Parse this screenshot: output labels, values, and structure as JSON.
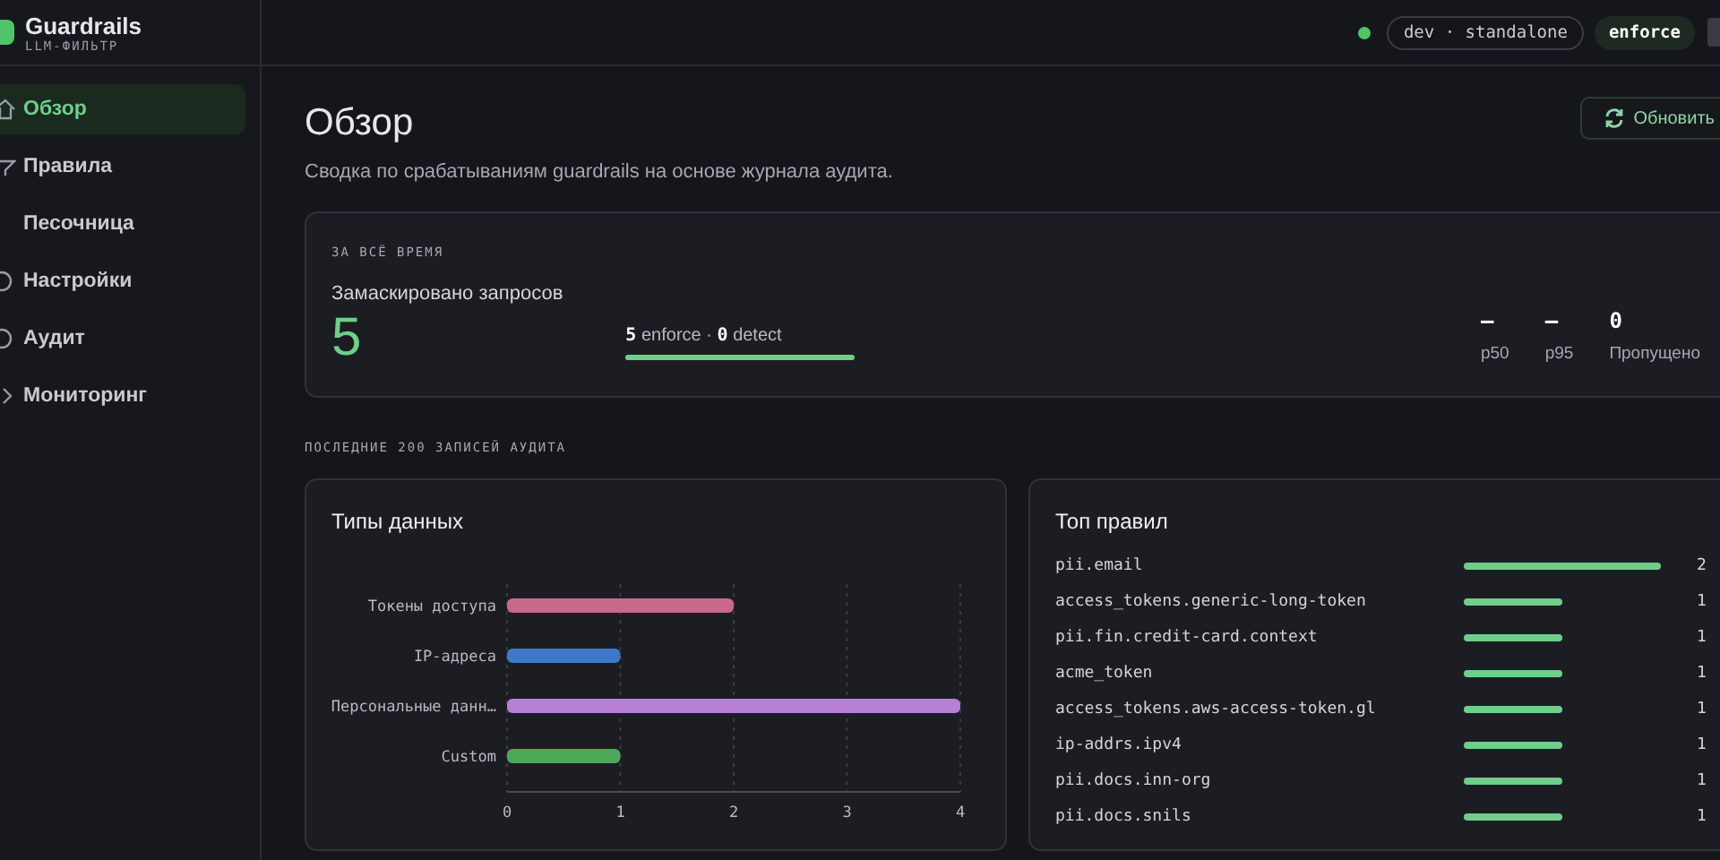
{
  "brand": {
    "title": "Guardrails",
    "subtitle": "LLM-ФИЛЬТР"
  },
  "sidebar": {
    "items": [
      {
        "label": "Обзор",
        "selected": true
      },
      {
        "label": "Правила",
        "selected": false
      },
      {
        "label": "Песочница",
        "selected": false
      },
      {
        "label": "Настройки",
        "selected": false
      },
      {
        "label": "Аудит",
        "selected": false
      },
      {
        "label": "Мониторинг",
        "selected": false
      }
    ]
  },
  "topbar": {
    "environment": "dev · standalone",
    "mode": "enforce"
  },
  "page": {
    "title": "Обзор",
    "subtitle": "Сводка по срабатываниям guardrails на основе журнала аудита.",
    "refresh_button": "Обновить"
  },
  "summary": {
    "section": "ЗА ВСЁ ВРЕМЯ",
    "label": "Замаскировано запросов",
    "value": "5",
    "enforce_count": "5",
    "enforce_label": "enforce",
    "separator": "·",
    "detect_count": "0",
    "detect_label": "detect",
    "level": 1,
    "stats": [
      {
        "value": "—",
        "label": "p50"
      },
      {
        "value": "—",
        "label": "p95"
      },
      {
        "value": "0",
        "label": "Пропущено"
      }
    ]
  },
  "recent_heading": "ПОСЛЕДНИЕ 200 ЗАПИСЕЙ АУДИТА",
  "data_types": {
    "title": "Типы данных",
    "chart_data": {
      "type": "bar",
      "orientation": "horizontal",
      "categories": [
        "Токены доступа",
        "IP-адреса",
        "Персональные данн…",
        "Custom"
      ],
      "values": [
        2,
        1,
        4,
        1
      ],
      "colors": [
        "#c8698c",
        "#3f78c8",
        "#b77fd6",
        "#4ea85a"
      ],
      "xlim": [
        0,
        4
      ],
      "xticks": [
        0,
        1,
        2,
        3,
        4
      ],
      "grid": true
    }
  },
  "top_rules": {
    "title": "Топ правил",
    "rows": [
      {
        "name": "pii.email",
        "count": "2"
      },
      {
        "name": "access_tokens.generic-long-token",
        "count": "1"
      },
      {
        "name": "pii.fin.credit-card.context",
        "count": "1"
      },
      {
        "name": "acme_token",
        "count": "1"
      },
      {
        "name": "access_tokens.aws-access-token.gl",
        "count": "1"
      },
      {
        "name": "ip-addrs.ipv4",
        "count": "1"
      },
      {
        "name": "pii.docs.inn-org",
        "count": "1"
      },
      {
        "name": "pii.docs.snils",
        "count": "1"
      }
    ]
  }
}
